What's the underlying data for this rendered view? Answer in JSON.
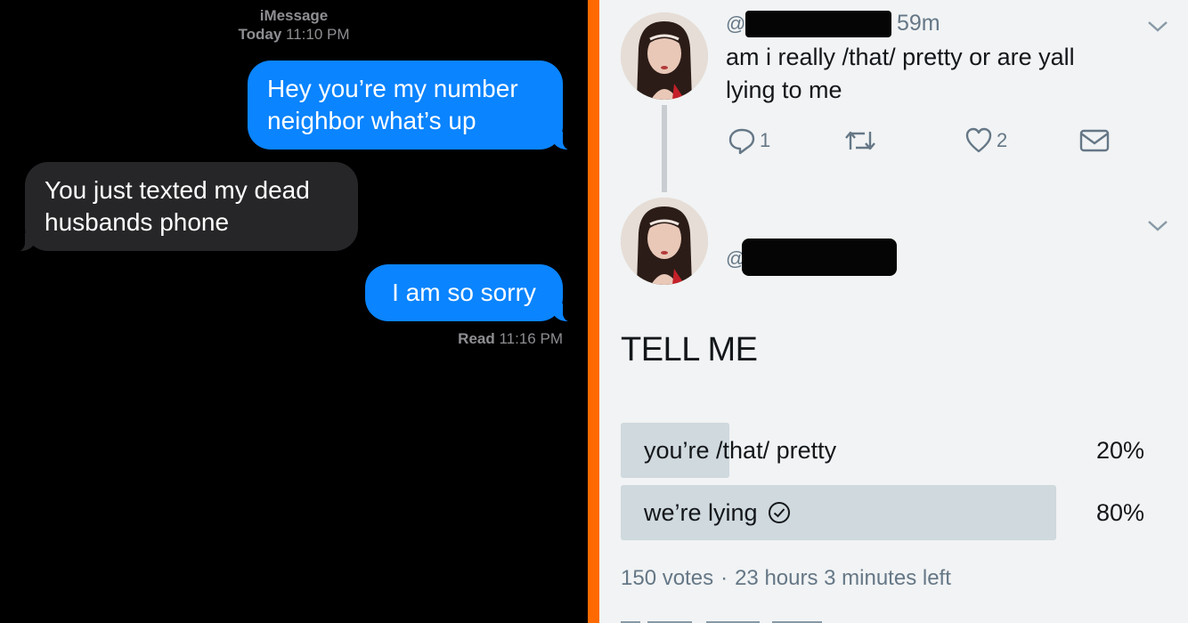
{
  "imessage": {
    "service": "iMessage",
    "date_day": "Today",
    "date_time": "11:10 PM",
    "messages": [
      {
        "direction": "sent",
        "text": "Hey you’re my number\nneighbor what’s up"
      },
      {
        "direction": "received",
        "text": "You just texted my dead\nhusbands phone"
      },
      {
        "direction": "sent",
        "text": "I am so sorry"
      }
    ],
    "read_label": "Read",
    "read_time": "11:16 PM",
    "colors": {
      "sent_bubble": "#0a84ff",
      "received_bubble": "#262628",
      "background": "#000000"
    }
  },
  "divider_color": "#ff6a00",
  "tweet": {
    "handle_prefix": "@",
    "time": "59m",
    "text": "am i really /that/ pretty or are yall\nlying to me",
    "actions": {
      "reply_icon": "reply-icon",
      "reply_count": "1",
      "retweet_icon": "retweet-icon",
      "like_icon": "heart-icon",
      "like_count": "2",
      "dm_icon": "envelope-icon"
    },
    "menu_icon": "chevron-down-icon"
  },
  "reply": {
    "handle_prefix": "@",
    "menu_icon": "chevron-down-icon",
    "poll": {
      "question": "TELL ME",
      "options": [
        {
          "label": "you’re /that/ pretty",
          "percent": "20%",
          "share": 0.2,
          "selected": false
        },
        {
          "label": "we’re lying",
          "percent": "80%",
          "share": 0.8,
          "selected": true
        }
      ],
      "votes": "150 votes",
      "separator": "·",
      "time_left": "23 hours 3 minutes left"
    }
  }
}
